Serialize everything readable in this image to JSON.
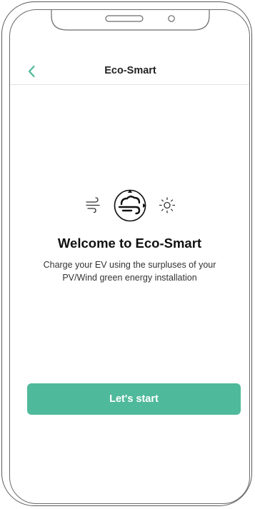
{
  "header": {
    "title": "Eco-Smart",
    "back_icon": "chevron-left-icon"
  },
  "hero": {
    "icons": [
      "wind-icon",
      "eco-smart-logo-icon",
      "sun-icon"
    ],
    "title": "Welcome to Eco-Smart",
    "subtitle_line1": "Charge your EV using the surpluses of your",
    "subtitle_line2": "PV/Wind green energy installation"
  },
  "actions": {
    "start_label": "Let's start"
  },
  "colors": {
    "accent": "#4fb99b",
    "back_chevron": "#4fb99b",
    "text": "#222222"
  }
}
